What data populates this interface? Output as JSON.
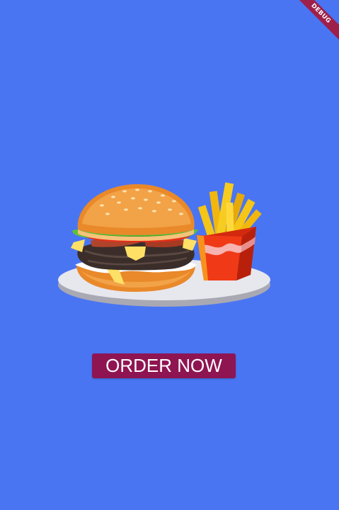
{
  "app": {
    "debug_banner": "DEBUG"
  },
  "hero": {
    "icon": "burger-and-fries-illustration"
  },
  "actions": {
    "order_label": "ORDER NOW"
  },
  "colors": {
    "background": "#4A75F2",
    "button": "#8F1552",
    "debug_banner": "#9E1F4A"
  }
}
